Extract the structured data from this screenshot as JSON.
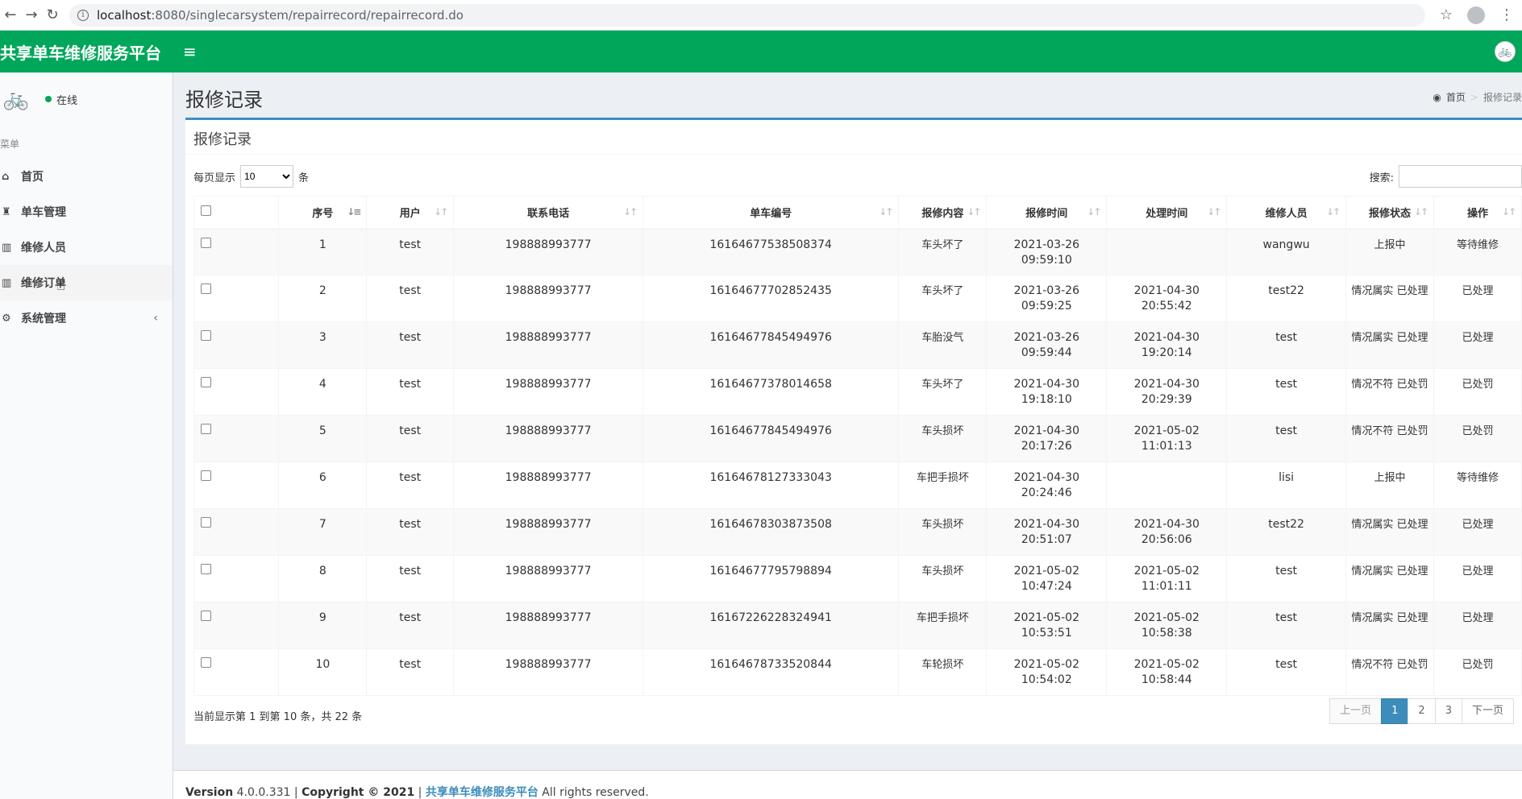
{
  "browser": {
    "url_host": "localhost",
    "url_path": ":8080/singlecarsystem/repairrecord/repairrecord.do"
  },
  "header": {
    "brand": "共享单车维修服务平台",
    "menu_toggle": "≡"
  },
  "sidebar": {
    "status": "在线",
    "menu_header": "菜单",
    "items": [
      {
        "label": "首页",
        "icon": "home-icon"
      },
      {
        "label": "单车管理",
        "icon": "trophy-icon"
      },
      {
        "label": "维修人员",
        "icon": "bar-chart-icon"
      },
      {
        "label": "维修订单",
        "icon": "bar-chart-icon"
      },
      {
        "label": "系统管理",
        "icon": "gear-icon"
      }
    ]
  },
  "content": {
    "page_title": "报修记录",
    "breadcrumb": {
      "home": "首页",
      "current": "报修记录"
    },
    "box_title": "报修记录",
    "length_label_pre": "每页显示",
    "length_value": "10",
    "length_label_post": "条",
    "search_label": "搜索:",
    "columns": [
      "序号",
      "用户",
      "联系电话",
      "单车编号",
      "报修内容",
      "报修时间",
      "处理时间",
      "维修人员",
      "报修状态",
      "操作"
    ],
    "rows": [
      [
        "1",
        "test",
        "198888993777",
        "16164677538508374",
        "车头坏了",
        "2021-03-26 09:59:10",
        "",
        "wangwu",
        "上报中",
        "等待维修"
      ],
      [
        "2",
        "test",
        "198888993777",
        "16164677702852435",
        "车头坏了",
        "2021-03-26 09:59:25",
        "2021-04-30 20:55:42",
        "test22",
        "情况属实 已处理",
        "已处理"
      ],
      [
        "3",
        "test",
        "198888993777",
        "16164677845494976",
        "车胎没气",
        "2021-03-26 09:59:44",
        "2021-04-30 19:20:14",
        "test",
        "情况属实 已处理",
        "已处理"
      ],
      [
        "4",
        "test",
        "198888993777",
        "16164677378014658",
        "车头坏了",
        "2021-04-30 19:18:10",
        "2021-04-30 20:29:39",
        "test",
        "情况不符 已处罚",
        "已处罚"
      ],
      [
        "5",
        "test",
        "198888993777",
        "16164677845494976",
        "车头损坏",
        "2021-04-30 20:17:26",
        "2021-05-02 11:01:13",
        "test",
        "情况不符 已处罚",
        "已处罚"
      ],
      [
        "6",
        "test",
        "198888993777",
        "16164678127333043",
        "车把手损坏",
        "2021-04-30 20:24:46",
        "",
        "lisi",
        "上报中",
        "等待维修"
      ],
      [
        "7",
        "test",
        "198888993777",
        "16164678303873508",
        "车头损坏",
        "2021-04-30 20:51:07",
        "2021-04-30 20:56:06",
        "test22",
        "情况属实 已处理",
        "已处理"
      ],
      [
        "8",
        "test",
        "198888993777",
        "16164677795798894",
        "车头损坏",
        "2021-05-02 10:47:24",
        "2021-05-02 11:01:11",
        "test",
        "情况属实 已处理",
        "已处理"
      ],
      [
        "9",
        "test",
        "198888993777",
        "16167226228324941",
        "车把手损坏",
        "2021-05-02 10:53:51",
        "2021-05-02 10:58:38",
        "test",
        "情况属实 已处理",
        "已处理"
      ],
      [
        "10",
        "test",
        "198888993777",
        "16164678733520844",
        "车轮损坏",
        "2021-05-02 10:54:02",
        "2021-05-02 10:58:44",
        "test",
        "情况不符 已处罚",
        "已处罚"
      ]
    ],
    "info": "当前显示第 1 到第 10 条，共 22 条",
    "pager": {
      "prev": "上一页",
      "pages": [
        "1",
        "2",
        "3"
      ],
      "next": "下一页",
      "active": "1"
    }
  },
  "footer": {
    "version_label": "Version",
    "version": "4.0.0.331",
    "copyright": "Copyright © 2021",
    "link": "共享单车维修服务平台",
    "rights": "All rights reserved."
  },
  "colors": {
    "header": "#00a65a",
    "accent": "#3c8dbc"
  }
}
